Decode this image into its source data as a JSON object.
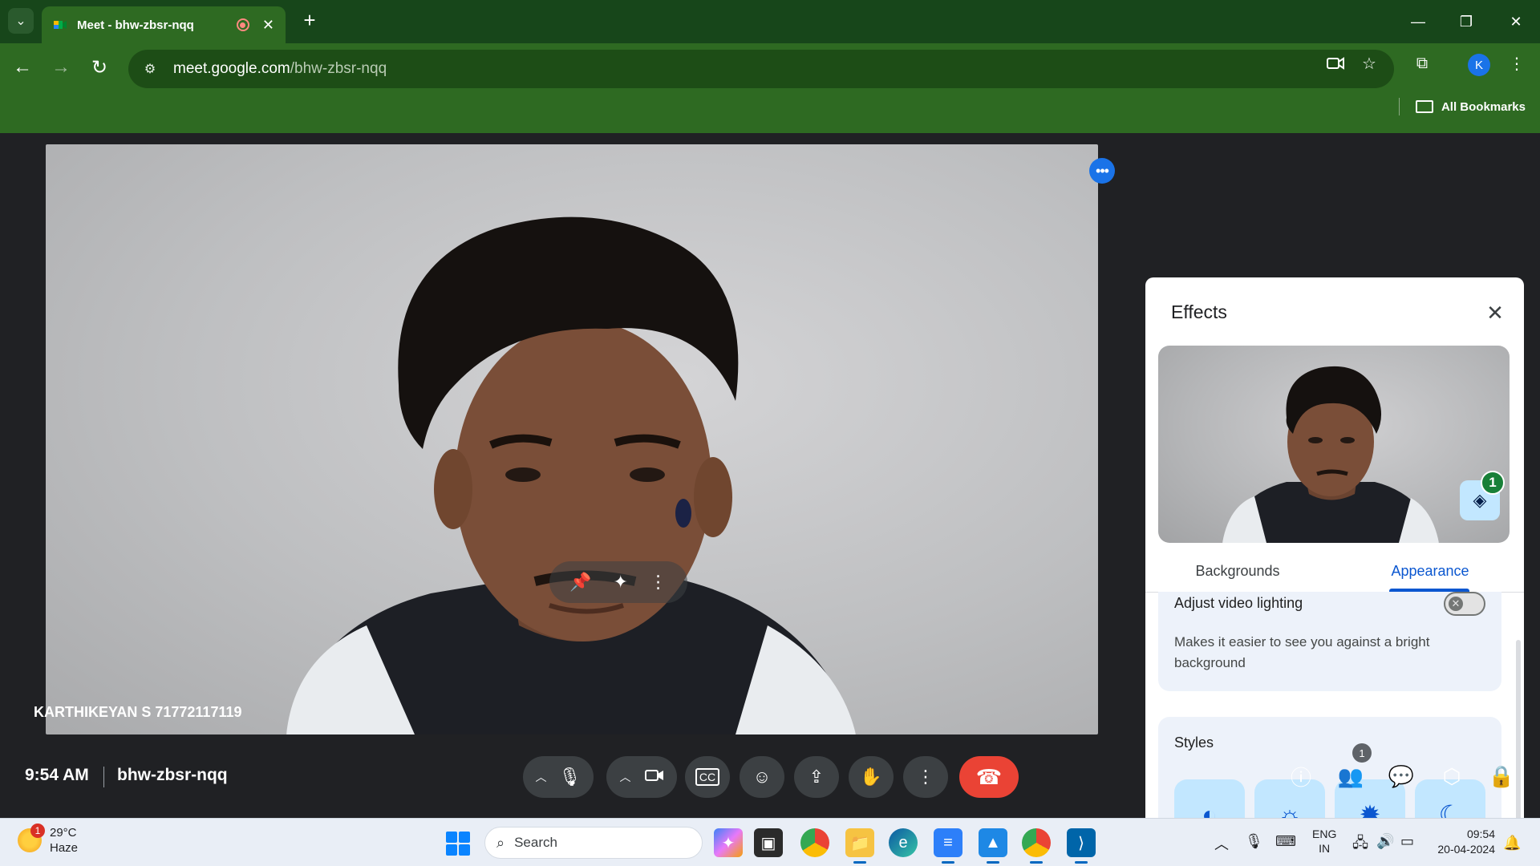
{
  "browser": {
    "tab_title": "Meet - bhw-zbsr-nqq",
    "tab_close": "✕",
    "new_tab": "+",
    "url_host": "meet.google.com",
    "url_path": "/bhw-zbsr-nqq",
    "profile_initial": "K",
    "bookmarks_label": "All Bookmarks"
  },
  "meet": {
    "participant_name": "KARTHIKEYAN S 71772117119",
    "time": "9:54 AM",
    "meeting_code": "bhw-zbsr-nqq",
    "people_count": "1"
  },
  "effects": {
    "title": "Effects",
    "layers_badge": "1",
    "tabs": [
      {
        "label": "Backgrounds",
        "active": false
      },
      {
        "label": "Appearance",
        "active": true
      }
    ],
    "adjust_lighting_label": "Adjust video lighting",
    "adjust_lighting_desc": "Makes it easier to see you against a bright background",
    "adjust_lighting_on": false,
    "styles_label": "Styles",
    "style_options": [
      "contrast-icon",
      "warm-sun-icon",
      "brightness-icon",
      "moon-icon"
    ]
  },
  "taskbar": {
    "weather_temp": "29°C",
    "weather_desc": "Haze",
    "weather_badge": "1",
    "search_placeholder": "Search",
    "lang_top": "ENG",
    "lang_bottom": "IN",
    "time": "09:54",
    "date": "20-04-2024"
  },
  "colors": {
    "browser_frame": "#17461a",
    "toolbar": "#2e6a22",
    "meet_bg": "#202124",
    "end_call": "#ea4335",
    "accent_blue": "#0b57d0"
  }
}
